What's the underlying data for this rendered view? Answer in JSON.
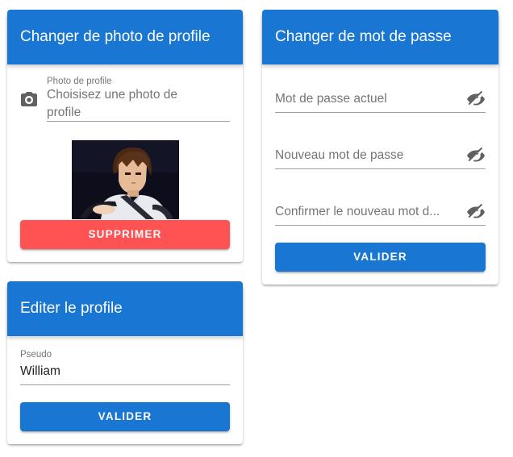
{
  "photo_card": {
    "title": "Changer de photo de profile",
    "field_label": "Photo de profile",
    "placeholder_line1": "Choisisez une photo de",
    "placeholder_line2": "profile",
    "delete_label": "SUPPRIMER",
    "icon": "camera-icon"
  },
  "profile_card": {
    "title": "Editer le profile",
    "pseudo_label": "Pseudo",
    "pseudo_value": "William",
    "submit_label": "VALIDER"
  },
  "password_card": {
    "title": "Changer de mot de passe",
    "fields": [
      {
        "placeholder": "Mot de passe actuel",
        "icon": "eye-off-icon"
      },
      {
        "placeholder": "Nouveau mot de passe",
        "icon": "eye-off-icon"
      },
      {
        "placeholder": "Confirmer le nouveau mot de passe",
        "display": "Confirmer le nouveau mot d...",
        "icon": "eye-off-icon"
      }
    ],
    "submit_label": "VALIDER"
  },
  "colors": {
    "primary": "#1976d2",
    "danger": "#ff5252",
    "icon_grey": "#616161"
  }
}
